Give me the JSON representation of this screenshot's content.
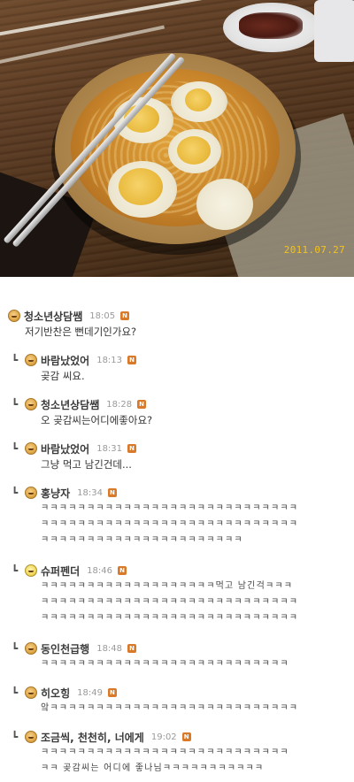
{
  "photo": {
    "date_stamp": "2011.07.27"
  },
  "comments": [
    {
      "nickname": "청소년상담쌤",
      "time": "18:05",
      "badge": "N",
      "reply": false,
      "lines": [
        "저기반찬은 뻔데기인가요?"
      ]
    },
    {
      "nickname": "바람났었어",
      "time": "18:13",
      "badge": "N",
      "reply": true,
      "lines": [
        "곶감 씨요."
      ]
    },
    {
      "nickname": "청소년상담쌤",
      "time": "18:28",
      "badge": "N",
      "reply": true,
      "lines": [
        "오 곶감씨는어디에좋아요?"
      ]
    },
    {
      "nickname": "바람났었어",
      "time": "18:31",
      "badge": "N",
      "reply": true,
      "lines": [
        "그냥 먹고 남긴건데..."
      ]
    },
    {
      "nickname": "홍냥자",
      "time": "18:34",
      "badge": "N",
      "reply": true,
      "lines": [
        "ㅋㅋㅋㅋㅋㅋㅋㅋㅋㅋㅋㅋㅋㅋㅋㅋㅋㅋㅋㅋㅋㅋㅋㅋㅋㅋㅋㅋ",
        "ㅋㅋㅋㅋㅋㅋㅋㅋㅋㅋㅋㅋㅋㅋㅋㅋㅋㅋㅋㅋㅋㅋㅋㅋㅋㅋㅋㅋ",
        "ㅋㅋㅋㅋㅋㅋㅋㅋㅋㅋㅋㅋㅋㅋㅋㅋㅋㅋㅋㅋㅋㅋ"
      ]
    },
    {
      "nickname": "슈퍼펜더",
      "time": "18:46",
      "badge": "N",
      "reply": true,
      "lines": [
        "ㅋㅋㅋㅋㅋㅋㅋㅋㅋㅋㅋㅋㅋㅋㅋㅋㅋㅋㅋ먹고 남긴걱ㅋㅋㅋ",
        "ㅋㅋㅋㅋㅋㅋㅋㅋㅋㅋㅋㅋㅋㅋㅋㅋㅋㅋㅋㅋㅋㅋㅋㅋㅋㅋㅋㅋ",
        "ㅋㅋㅋㅋㅋㅋㅋㅋㅋㅋㅋㅋㅋㅋㅋㅋㅋㅋㅋㅋㅋㅋㅋㅋㅋㅋㅋㅋ"
      ]
    },
    {
      "nickname": "동인천급행",
      "time": "18:48",
      "badge": "N",
      "reply": true,
      "lines": [
        "ㅋㅋㅋㅋㅋㅋㅋㅋㅋㅋㅋㅋㅋㅋㅋㅋㅋㅋㅋㅋㅋㅋㅋㅋㅋㅋㅋ"
      ]
    },
    {
      "nickname": "히오힝",
      "time": "18:49",
      "badge": "N",
      "reply": true,
      "lines": [
        "앜ㅋㅋㅋㅋㅋㅋㅋㅋㅋㅋㅋㅋㅋㅋㅋㅋㅋㅋㅋㅋㅋㅋㅋㅋㅋㅋㅋ"
      ]
    },
    {
      "nickname": "조금씩, 천천히, 너에게",
      "time": "19:02",
      "badge": "N",
      "reply": true,
      "lines": [
        "ㅋㅋㅋㅋㅋㅋㅋㅋㅋㅋㅋㅋㅋㅋㅋㅋㅋㅋㅋㅋㅋㅋㅋㅋㅋㅋㅋ",
        "ㅋㅋ 곶감씨는 어디에 좋나님ㅋㅋㅋㅋㅋㅋㅋㅋㅋㅋㅋ"
      ]
    }
  ]
}
